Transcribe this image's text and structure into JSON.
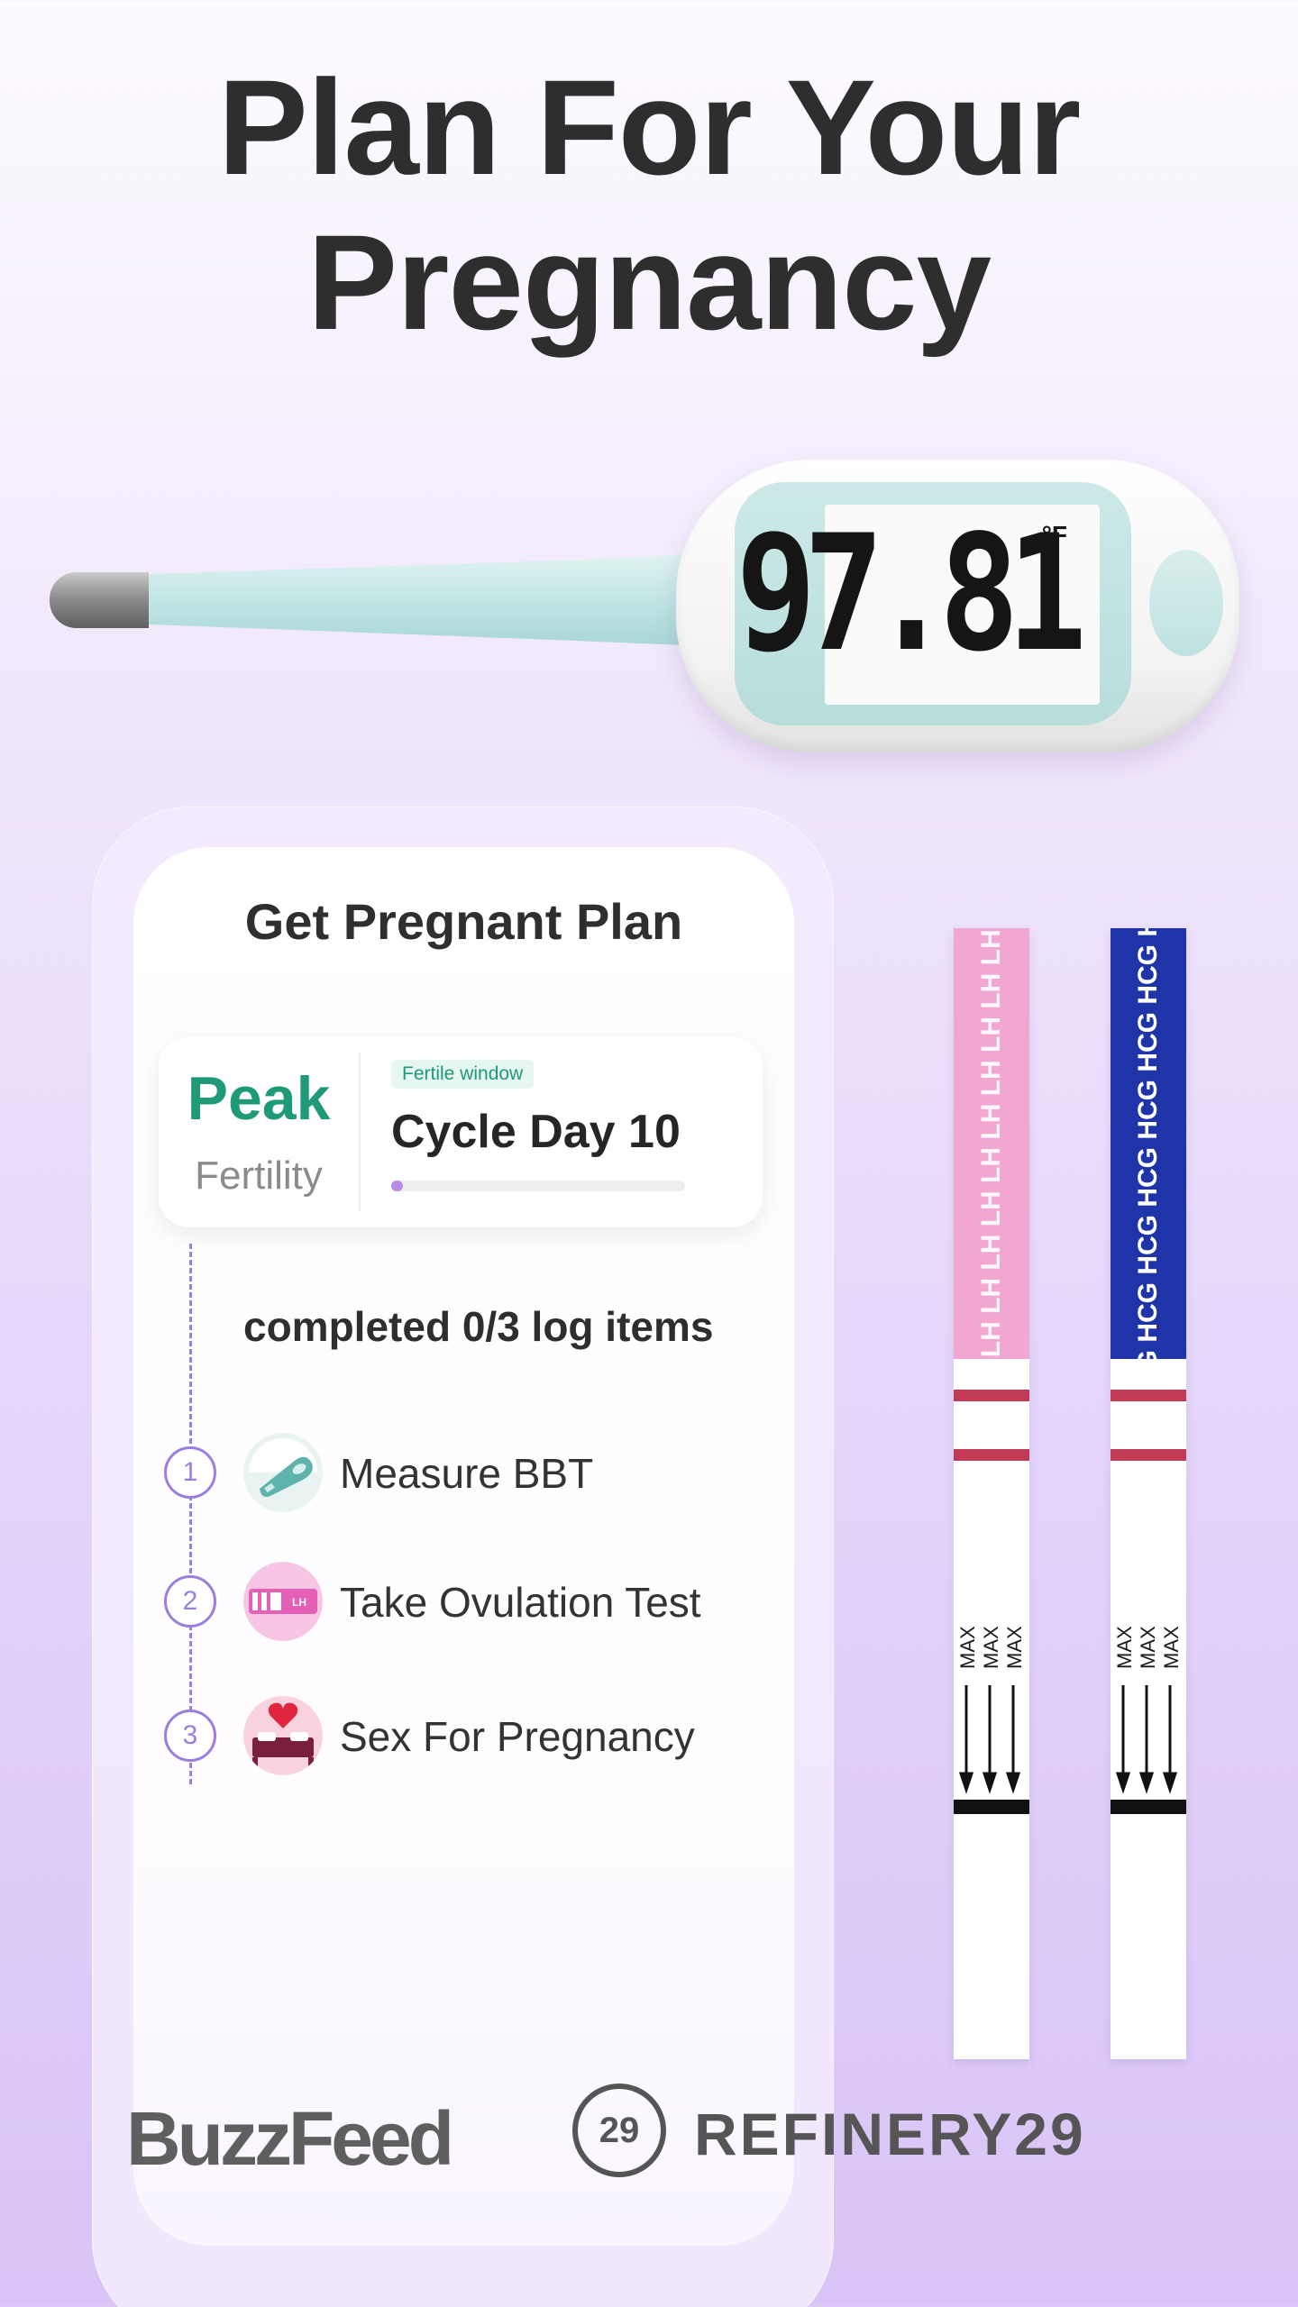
{
  "headline": {
    "line1": "Plan For Your",
    "line2": "Pregnancy"
  },
  "thermometer": {
    "reading": "97.81",
    "unit": "°F"
  },
  "plan": {
    "title": "Get Pregnant Plan",
    "fertility_level": "Peak",
    "fertility_label": "Fertility",
    "window_badge": "Fertile window",
    "cycle_day": "Cycle Day 10",
    "cycle_progress": 0.04,
    "completed_text": "completed 0/3 log items",
    "items": [
      {
        "num": "1",
        "label": "Measure BBT",
        "icon": "thermometer-icon"
      },
      {
        "num": "2",
        "label": "Take Ovulation Test",
        "icon": "ovulation-test-icon"
      },
      {
        "num": "3",
        "label": "Sex For Pregnancy",
        "icon": "bed-heart-icon"
      }
    ]
  },
  "strips": {
    "lh_text": "LH LH LH LH LH LH LH LH LH LH LH LH",
    "hcg_text": "HCG HCG HCG HCG HCG HCG HCG HCG",
    "max": "MAX"
  },
  "logos": {
    "buzzfeed": "BuzzFeed",
    "refinery_mark": "29",
    "refinery": "REFINERY29"
  },
  "colors": {
    "accent_purple": "#9b7ee0",
    "peak_green": "#1e9a78",
    "lh_pink": "#f1a7d2",
    "hcg_blue": "#1e34a8"
  }
}
